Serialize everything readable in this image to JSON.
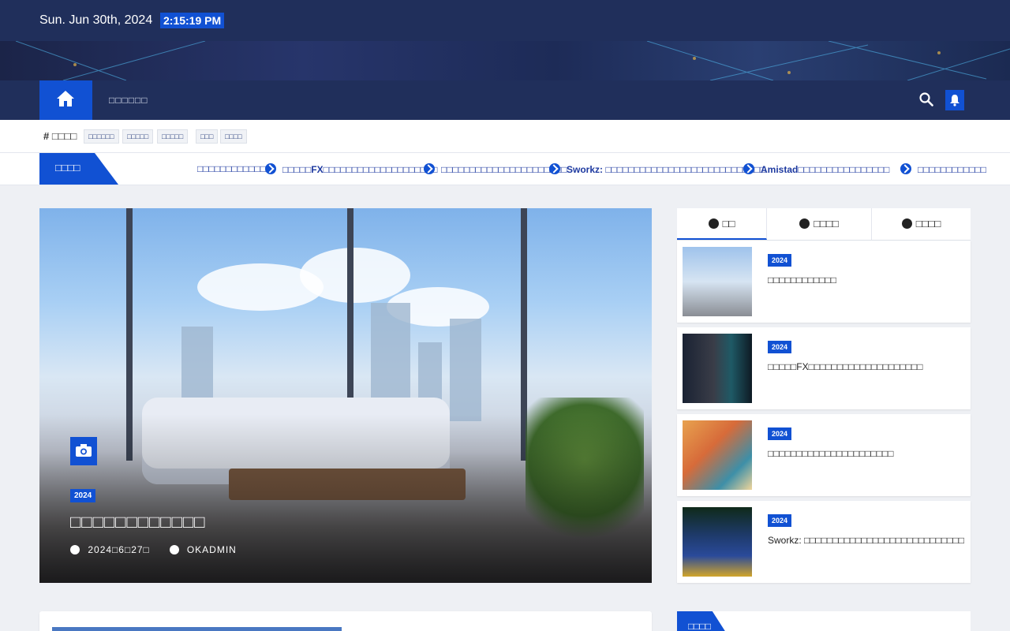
{
  "topbar": {
    "date": "Sun. Jun 30th, 2024",
    "time": "2:15:19 PM"
  },
  "navbar": {
    "menu_label": "□□□□□□"
  },
  "tags": {
    "title": "□□□□",
    "items": [
      "□□□□□□",
      "□□□□□",
      "□□□□□",
      "□□□",
      "□□□□"
    ]
  },
  "ticker": {
    "label": "□□□□",
    "items": [
      "□□□□□□□□□□□□",
      "□□□□□FX□□□□□□□□□□□□□□□□□□□□",
      "□□□□□□□□□□□□□□□□□□□□□□",
      "Sworkz: □□□□□□□□□□□□□□□□□□□□□□□□□□□□",
      "Amistad□□□□□□□□□□□□□□□□",
      "□□□□□□□□□□□□"
    ]
  },
  "hero": {
    "badge": "2024",
    "title": "□□□□□□□□□□□□",
    "date": "2024□6□27□",
    "author": "OKADMIN"
  },
  "sidebar": {
    "tabs": [
      "□□",
      "□□□□",
      "□□□□"
    ],
    "posts": [
      {
        "badge": "2024",
        "title": "□□□□□□□□□□□□"
      },
      {
        "badge": "2024",
        "title": "□□□□□FX□□□□□□□□□□□□□□□□□□□□"
      },
      {
        "badge": "2024",
        "title": "□□□□□□□□□□□□□□□□□□□□□□"
      },
      {
        "badge": "2024",
        "title": "Sworkz: □□□□□□□□□□□□□□□□□□□□□□□□□□□□"
      }
    ],
    "bottom_label": "□□□□"
  },
  "colors": {
    "primary": "#1151d3",
    "navy": "#202f5b",
    "background": "#eef0f4"
  }
}
